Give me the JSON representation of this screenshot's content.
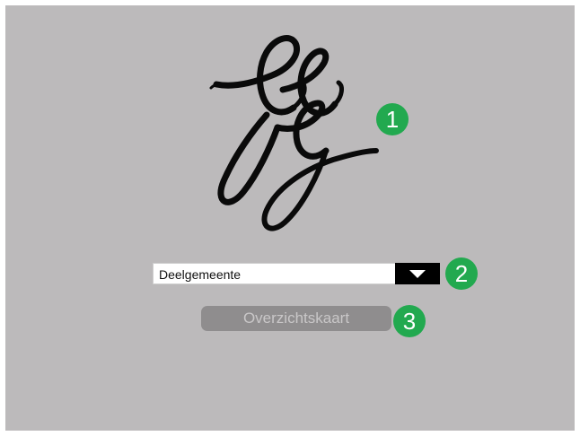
{
  "logo": {
    "icon": "gg-monogram-logo",
    "text": "GG"
  },
  "dropdown": {
    "selected": "Deelgemeente",
    "icon": "chevron-down-icon"
  },
  "overview_button": {
    "label": "Overzichtskaart"
  },
  "annotations": {
    "badge_1": "1",
    "badge_2": "2",
    "badge_3": "3"
  },
  "colors": {
    "background": "#bcbabb",
    "badge": "#22a94f",
    "button": "#8f8d8e",
    "dropdown_arrow_bg": "#000000"
  }
}
